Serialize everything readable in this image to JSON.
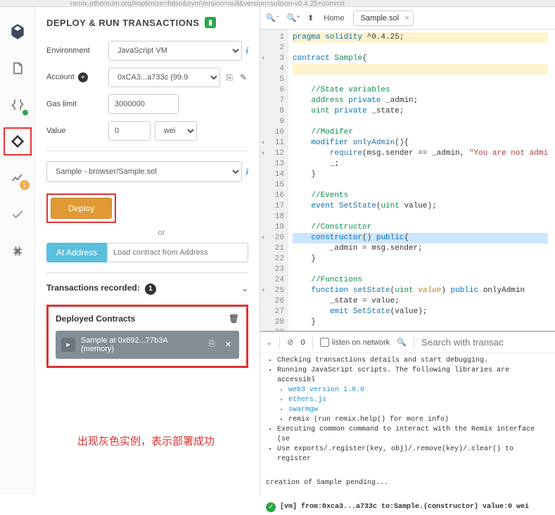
{
  "topbar": "remix.ethereum.org/#optimize=false&evmVersion=null&version=soljson-v0.4.25+commit",
  "panel": {
    "title": "DEPLOY & RUN TRANSACTIONS",
    "env_label": "Environment",
    "env_value": "JavaScript VM",
    "acct_label": "Account",
    "acct_value": "0xCA3...a733c (99.9",
    "gas_label": "Gas limit",
    "gas_value": "3000000",
    "val_label": "Value",
    "val_value": "0",
    "val_unit": "wei",
    "contract_value": "Sample - browser/Sample.sol",
    "deploy_btn": "Deploy",
    "or_text": "or",
    "ataddr_btn": "At Address",
    "ataddr_placeholder": "Load contract from Address",
    "trec_label": "Transactions recorded:",
    "trec_count": "1",
    "deployed_title": "Deployed Contracts",
    "instance_name": "Sample at 0x692...77b3A (memory)"
  },
  "annotation": "出现灰色实例，表示部署成功",
  "editor": {
    "home": "Home",
    "tab": "Sample.sol",
    "lines": [
      {
        "n": "1",
        "cls": "hl-warn",
        "html": "<span class='kw'>pragma</span> <span class='kw'>solidity</span> ^0.4.25;"
      },
      {
        "n": "2",
        "html": ""
      },
      {
        "n": "3",
        "fold": true,
        "html": "<span class='kw'>contract</span> <span class='type'>Sample</span>{"
      },
      {
        "n": "4",
        "cls": "hl-warn",
        "html": ""
      },
      {
        "n": "5",
        "html": ""
      },
      {
        "n": "6",
        "html": "    <span class='cm'>//State variables</span>"
      },
      {
        "n": "7",
        "html": "    <span class='type'>address</span> <span class='kw'>private</span> _admin;"
      },
      {
        "n": "8",
        "html": "    <span class='type'>uint</span> <span class='kw'>private</span> _state;"
      },
      {
        "n": "9",
        "html": ""
      },
      {
        "n": "10",
        "html": "    <span class='cm'>//Modifer</span>"
      },
      {
        "n": "11",
        "fold": true,
        "html": "    <span class='kw'>modifier</span> <span class='fn'>onlyAdmin</span>(){"
      },
      {
        "n": "12",
        "fold": true,
        "html": "        <span class='fn'>require</span>(msg.sender == _admin, <span class='str'>\"You are not admi</span>"
      },
      {
        "n": "13",
        "html": "        _;"
      },
      {
        "n": "14",
        "html": "    }"
      },
      {
        "n": "15",
        "html": ""
      },
      {
        "n": "16",
        "html": "    <span class='cm'>//Events</span>"
      },
      {
        "n": "17",
        "html": "    <span class='kw'>event</span> <span class='fn'>SetState</span>(<span class='type'>uint</span> value);"
      },
      {
        "n": "18",
        "html": ""
      },
      {
        "n": "19",
        "html": "    <span class='cm'>//Constructor</span>"
      },
      {
        "n": "20",
        "fold": true,
        "cls": "hl-active",
        "html": "    <span class='kw'>constructor</span>() <span class='kw'>public</span>{"
      },
      {
        "n": "21",
        "html": "        _admin = msg.sender;"
      },
      {
        "n": "22",
        "html": "    }"
      },
      {
        "n": "23",
        "html": ""
      },
      {
        "n": "24",
        "html": "    <span class='cm'>//Functions</span>"
      },
      {
        "n": "25",
        "fold": true,
        "html": "    <span class='kw'>function</span> <span class='fn'>setState</span>(<span class='type'>uint</span> <span class='var'>value</span>) <span class='kw'>public</span> onlyAdmin"
      },
      {
        "n": "26",
        "html": "        _state = value;"
      },
      {
        "n": "27",
        "html": "        <span class='kw'>emit</span> <span class='fn'>SetState</span>(value);"
      },
      {
        "n": "28",
        "html": "    }"
      },
      {
        "n": "29",
        "html": ""
      }
    ]
  },
  "terminal": {
    "zero": "0",
    "listen": "listen on network",
    "search_placeholder": "Search with transac",
    "l1": "Checking transactions details and start debugging.",
    "l2": "Running JavaScript scripts. The following libraries are accessibl",
    "links": [
      "web3 version 1.0.0",
      "ethers.js",
      "swarmgw"
    ],
    "l3": "remix (run remix.help() for more info)",
    "l4": "Executing common command to interact with the Remix interface (se",
    "l5": "Use exports/.register(key, obj)/.remove(key)/.clear() to register",
    "pending": "creation of Sample pending...",
    "lastline": "[vm] from:0xca3...a733c to:Sample.(constructor) value:0 wei"
  },
  "sidebar": {
    "badge": "1"
  }
}
